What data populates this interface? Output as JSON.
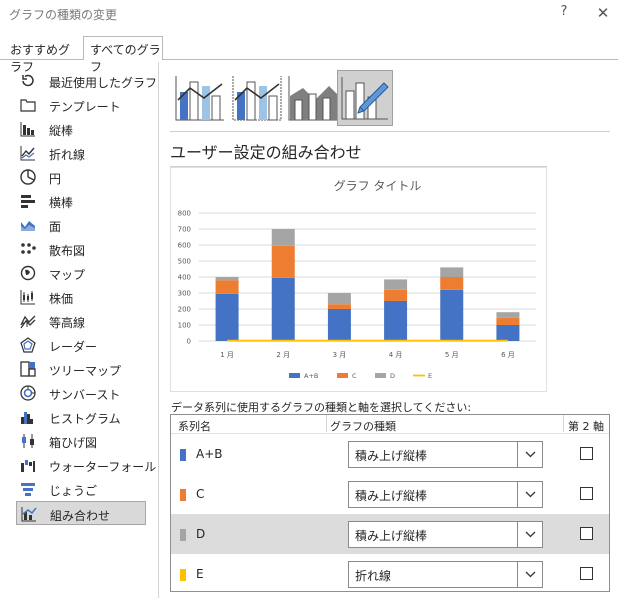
{
  "window": {
    "title": "グラフの種類の変更",
    "help_glyph": "?",
    "close_glyph": "✕"
  },
  "tabs": [
    {
      "label": "おすすめグラフ",
      "active": false
    },
    {
      "label": "すべてのグラフ",
      "active": true
    }
  ],
  "sidebar": {
    "items": [
      {
        "label": "最近使用したグラフ",
        "icon": "recent-icon"
      },
      {
        "label": "テンプレート",
        "icon": "folder-icon"
      },
      {
        "label": "縦棒",
        "icon": "column-chart-icon"
      },
      {
        "label": "折れ線",
        "icon": "line-chart-icon"
      },
      {
        "label": "円",
        "icon": "pie-chart-icon"
      },
      {
        "label": "横棒",
        "icon": "bar-chart-icon"
      },
      {
        "label": "面",
        "icon": "area-chart-icon"
      },
      {
        "label": "散布図",
        "icon": "scatter-chart-icon"
      },
      {
        "label": "マップ",
        "icon": "map-chart-icon"
      },
      {
        "label": "株価",
        "icon": "stock-chart-icon"
      },
      {
        "label": "等高線",
        "icon": "surface-chart-icon"
      },
      {
        "label": "レーダー",
        "icon": "radar-chart-icon"
      },
      {
        "label": "ツリーマップ",
        "icon": "treemap-icon"
      },
      {
        "label": "サンバースト",
        "icon": "sunburst-icon"
      },
      {
        "label": "ヒストグラム",
        "icon": "histogram-icon"
      },
      {
        "label": "箱ひげ図",
        "icon": "box-whisker-icon"
      },
      {
        "label": "ウォーターフォール",
        "icon": "waterfall-icon"
      },
      {
        "label": "じょうご",
        "icon": "funnel-icon"
      },
      {
        "label": "組み合わせ",
        "icon": "combo-chart-icon",
        "selected": true
      }
    ]
  },
  "subtypes": [
    {
      "icon": "clustered-column-line-icon"
    },
    {
      "icon": "clustered-column-line-secondary-icon"
    },
    {
      "icon": "stacked-area-column-icon"
    },
    {
      "icon": "custom-combination-icon",
      "selected": true
    }
  ],
  "section_heading": "ユーザー設定の組み合わせ",
  "chart_data": {
    "type": "bar",
    "title": "グラフ タイトル",
    "categories": [
      "1 月",
      "2 月",
      "3 月",
      "4 月",
      "5 月",
      "6 月"
    ],
    "stacked": true,
    "series": [
      {
        "name": "A+B",
        "chart": "stacked-column",
        "color": "#4472C4",
        "values": [
          295,
          395,
          200,
          250,
          320,
          100
        ]
      },
      {
        "name": "C",
        "chart": "stacked-column",
        "color": "#ED7D31",
        "values": [
          85,
          200,
          30,
          70,
          80,
          45
        ]
      },
      {
        "name": "D",
        "chart": "stacked-column",
        "color": "#A5A5A5",
        "values": [
          20,
          105,
          70,
          65,
          60,
          35
        ]
      },
      {
        "name": "E",
        "chart": "line",
        "color": "#FFC000",
        "values": [
          2,
          2,
          2,
          2,
          2,
          2
        ]
      }
    ],
    "ylim": [
      0,
      800
    ],
    "yticks": [
      "0",
      "100",
      "200",
      "300",
      "400",
      "500",
      "600",
      "700",
      "800"
    ],
    "grid": true,
    "legend": "bottom"
  },
  "instruction": "データ系列に使用するグラフの種類と軸を選択してください:",
  "table": {
    "headers": {
      "series": "系列名",
      "type": "グラフの種類",
      "axis": "第 2 軸"
    },
    "rows": [
      {
        "name": "A+B",
        "color": "#4472C4",
        "type": "積み上げ縦棒",
        "secondary": false
      },
      {
        "name": "C",
        "color": "#ED7D31",
        "type": "積み上げ縦棒",
        "secondary": false
      },
      {
        "name": "D",
        "color": "#A5A5A5",
        "type": "積み上げ縦棒",
        "secondary": false,
        "highlighted": true
      },
      {
        "name": "E",
        "color": "#FFC000",
        "type": "折れ線",
        "secondary": false
      }
    ]
  }
}
